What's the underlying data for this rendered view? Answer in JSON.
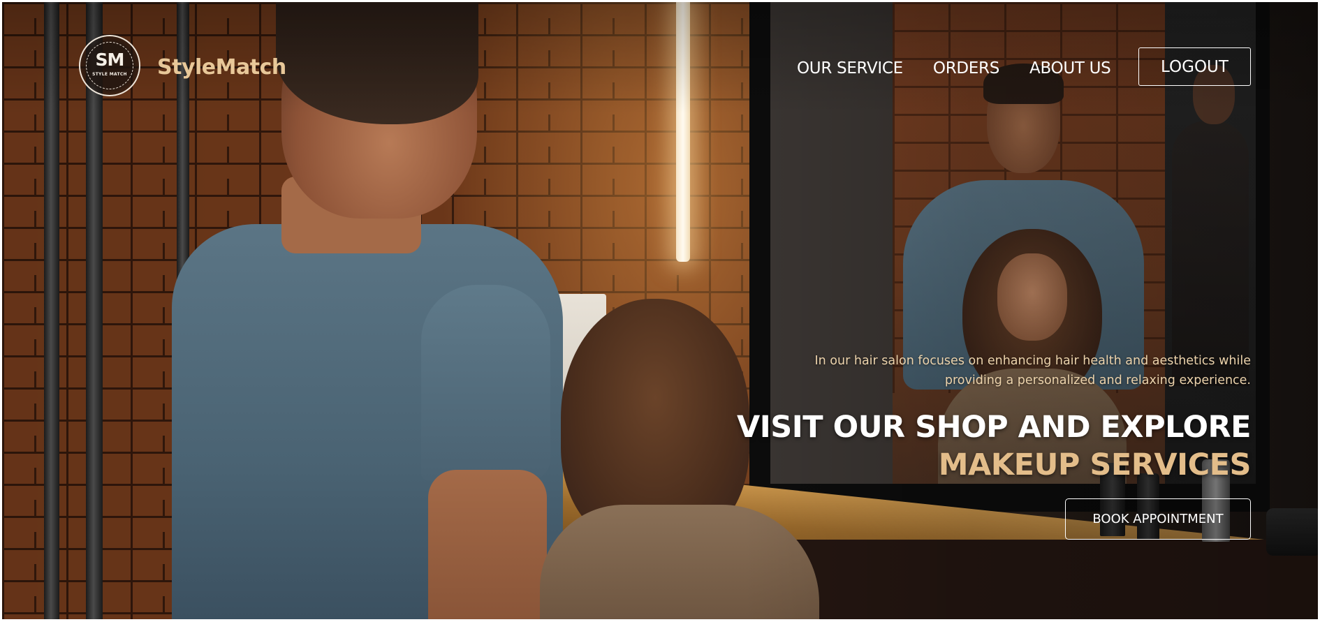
{
  "header": {
    "logo": {
      "monogram": "SM",
      "subtitle": "STYLE MATCH"
    },
    "brand_name": "StyleMatch",
    "nav": [
      {
        "label": "OUR SERVICE"
      },
      {
        "label": "ORDERS"
      },
      {
        "label": "ABOUT US"
      }
    ],
    "logout_label": "LOGOUT"
  },
  "hero": {
    "tagline_line1": "In our hair salon focuses on enhancing hair health and aesthetics while",
    "tagline_line2": "providing a personalized and relaxing experience.",
    "headline_line1": "VISIT OUR SHOP AND EXPLORE",
    "headline_line2": "MAKEUP SERVICES",
    "cta_label": "BOOK APPOINTMENT"
  },
  "colors": {
    "brand": "#e8c899",
    "headline_accent": "#e3bd8a",
    "tagline": "#ecd3ac",
    "text_light": "#ffffff"
  }
}
